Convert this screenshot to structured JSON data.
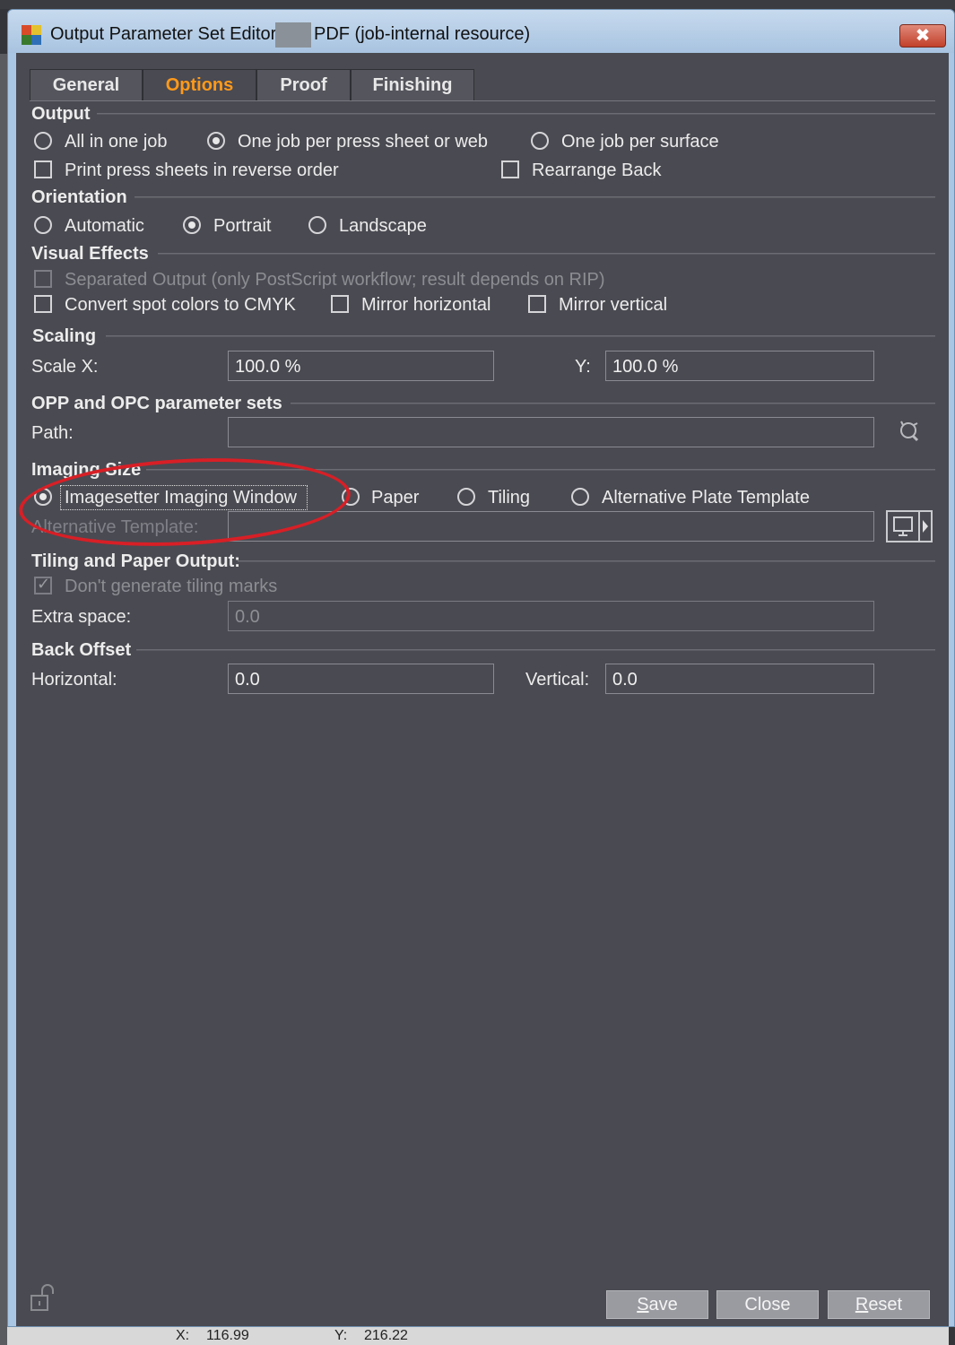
{
  "window": {
    "title": "Output Parameter Set Editor:",
    "title_suffix": "PDF (job-internal resource)",
    "close_glyph": "✖"
  },
  "tabs": [
    {
      "label": "General",
      "active": false
    },
    {
      "label": "Options",
      "active": true
    },
    {
      "label": "Proof",
      "active": false
    },
    {
      "label": "Finishing",
      "active": false
    }
  ],
  "output": {
    "title": "Output",
    "radios": [
      "All in one job",
      "One job per press sheet or web",
      "One job per surface"
    ],
    "selected": "One job per press sheet or web",
    "reverse_order": "Print press sheets in reverse order",
    "rearrange_back": "Rearrange Back"
  },
  "orientation": {
    "title": "Orientation",
    "radios": [
      "Automatic",
      "Portrait",
      "Landscape"
    ],
    "selected": "Portrait"
  },
  "visual_effects": {
    "title": "Visual Effects",
    "separated": "Separated Output (only PostScript workflow; result depends on RIP)",
    "spot_to_cmyk": "Convert spot colors to CMYK",
    "mirror_h": "Mirror horizontal",
    "mirror_v": "Mirror vertical"
  },
  "scaling": {
    "title": "Scaling",
    "x_label": "Scale X:",
    "x_value": "100.0 %",
    "y_label": "Y:",
    "y_value": "100.0 %"
  },
  "opp": {
    "title": "OPP and OPC parameter sets",
    "path_label": "Path:",
    "path_value": ""
  },
  "imaging": {
    "title": "Imaging Size",
    "radios": [
      "Imagesetter Imaging Window",
      "Paper",
      "Tiling",
      "Alternative Plate Template"
    ],
    "selected": "Imagesetter Imaging Window",
    "template_label": "Alternative Template:",
    "template_value": ""
  },
  "tiling": {
    "title": "Tiling and Paper Output:",
    "no_marks": "Don't generate tiling marks",
    "extra_label": "Extra space:",
    "extra_value": "0.0"
  },
  "back_offset": {
    "title": "Back Offset",
    "h_label": "Horizontal:",
    "h_value": "0.0",
    "v_label": "Vertical:",
    "v_value": "0.0"
  },
  "buttons": {
    "save": {
      "first": "S",
      "rest": "ave"
    },
    "close": "Close",
    "reset": {
      "first": "R",
      "rest": "eset"
    }
  },
  "status": {
    "x_label": "X:",
    "x_value": "116.99",
    "y_label": "Y:",
    "y_value": "216.22"
  },
  "colors": {
    "accent_tab": "#ff9a1a",
    "panel_bg": "#4a4a52",
    "annotation": "#d81f26"
  }
}
